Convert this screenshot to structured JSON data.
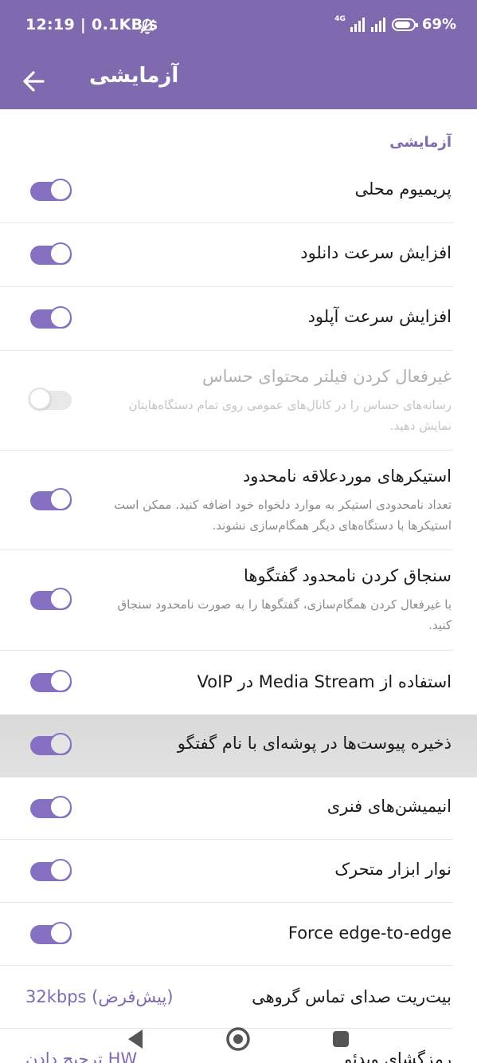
{
  "status_bar": {
    "time_speed": "12:19 | 0.1KB/s",
    "network": "4G",
    "battery": "69%"
  },
  "header": {
    "title": "آزمایشی"
  },
  "section": {
    "title": "آزمایشی"
  },
  "colors": {
    "accent": "#7f6ab0",
    "toggle_on": "#8570c2",
    "highlight": "#dcdcdc"
  },
  "settings": [
    {
      "title": "پریمیوم محلی",
      "enabled": true
    },
    {
      "title": "افزایش سرعت دانلود",
      "enabled": true
    },
    {
      "title": "افزایش سرعت آپلود",
      "enabled": true
    },
    {
      "title": "غیرفعال کردن فیلتر محتوای حساس",
      "description": "رسانه‌های حساس را در کانال‌های عمومی روی تمام دستگاه‌هایتان نمایش دهید.",
      "enabled": false,
      "disabled": true
    },
    {
      "title": "استیکرهای موردعلاقه نامحدود",
      "description": "تعداد نامحدودی استیکر به موارد دلخواه خود اضافه کنید. ممکن است استیکرها با دستگاه‌های دیگر همگام‌سازی نشوند.",
      "enabled": true
    },
    {
      "title": "سنجاق کردن نامحدود گفتگوها",
      "description": "با غیرفعال کردن همگام‌سازی، گفتگوها را به صورت نامحدود سنجاق کنید.",
      "enabled": true
    },
    {
      "title": "استفاده از Media Stream در VoIP",
      "enabled": true
    },
    {
      "title": "ذخیره پیوست‌ها در پوشه‌ای با نام گفتگو",
      "enabled": true
    },
    {
      "title": "انیمیشن‌های فنری",
      "enabled": true
    },
    {
      "title": "نوار ابزار متحرک",
      "enabled": true
    },
    {
      "title": "Force edge-to-edge",
      "enabled": true
    }
  ],
  "group_call_bitrate": {
    "title": "بیت‌ریت صدای تماس گروهی",
    "value": "32kbps (پیش‌فرض)"
  },
  "video_codec": {
    "title": "رمزگشای ویدئو",
    "value": "ترجیح دادن HW"
  },
  "nav_bar": {
    "back_icon": "triangle-back-icon",
    "home_icon": "circle-home-icon",
    "recents_icon": "square-recents-icon"
  }
}
